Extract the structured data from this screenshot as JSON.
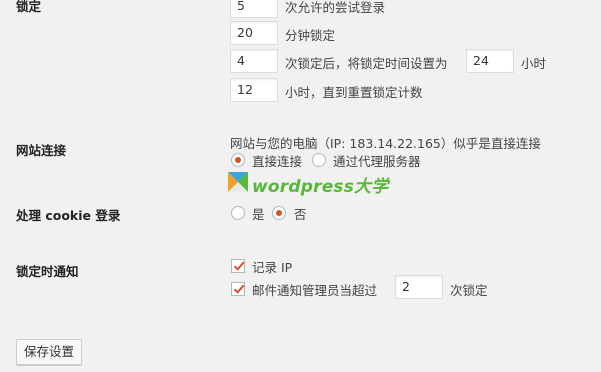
{
  "lockout": {
    "label": "锁定",
    "attempts_value": "5",
    "attempts_suffix": "次允许的尝试登录",
    "minutes_value": "20",
    "minutes_suffix": "分钟锁定",
    "lockouts_value": "4",
    "lockouts_middle": "次锁定后，将锁定时间设置为",
    "hours_value": "24",
    "hours_suffix": "小时",
    "reset_value": "12",
    "reset_suffix": "小时，直到重置锁定计数"
  },
  "connection": {
    "label": "网站连接",
    "description": "网站与您的电脑（IP: 183.14.22.165）似乎是直接连接",
    "option_direct": "直接连接",
    "option_proxy": "通过代理服务器",
    "selected": "direct"
  },
  "cookie": {
    "label": "处理 cookie 登录",
    "option_yes": "是",
    "option_no": "否",
    "selected": "no"
  },
  "notify": {
    "label": "锁定时通知",
    "log_ip_label": "记录 IP",
    "log_ip_checked": true,
    "email_prefix": "邮件通知管理员当超过",
    "email_value": "2",
    "email_suffix": "次锁定",
    "email_checked": true
  },
  "watermark": {
    "text": "wordpress大学",
    "colors": [
      "#f0a026",
      "#3aa6d8",
      "#59b83a"
    ]
  },
  "save_button": "保存设置"
}
